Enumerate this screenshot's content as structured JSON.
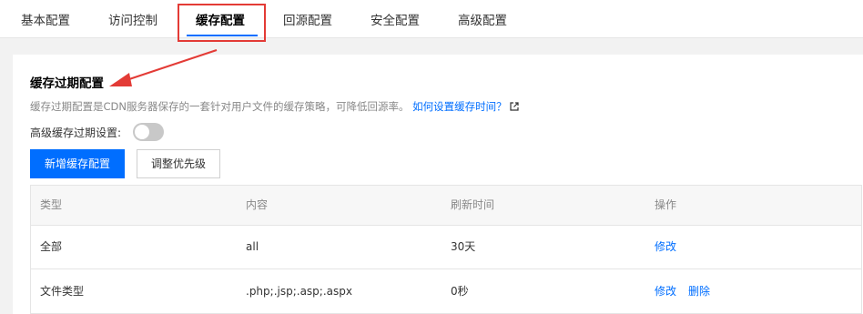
{
  "tabs": [
    "基本配置",
    "访问控制",
    "缓存配置",
    "回源配置",
    "安全配置",
    "高级配置"
  ],
  "section": {
    "title": "缓存过期配置",
    "description": "缓存过期配置是CDN服务器保存的一套针对用户文件的缓存策略，可降低回源率。",
    "help_link": "如何设置缓存时间？",
    "toggle_label": "高级缓存过期设置:"
  },
  "buttons": {
    "add": "新增缓存配置",
    "priority": "调整优先级"
  },
  "table": {
    "headers": [
      "类型",
      "内容",
      "刷新时间",
      "操作"
    ],
    "rows": [
      {
        "type": "全部",
        "content": "all",
        "refresh": "30天",
        "actions": [
          "修改"
        ]
      },
      {
        "type": "文件类型",
        "content": ".php;.jsp;.asp;.aspx",
        "refresh": "0秒",
        "actions": [
          "修改",
          "删除"
        ]
      }
    ]
  },
  "colors": {
    "accent": "#006eff",
    "annotation": "#e33b36"
  }
}
